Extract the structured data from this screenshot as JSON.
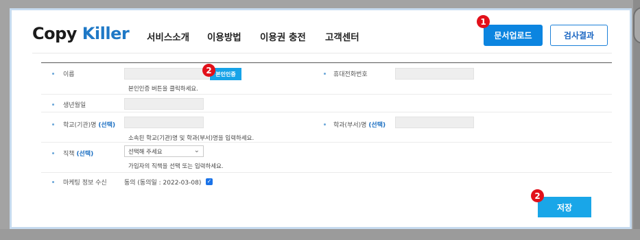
{
  "header": {
    "logo": {
      "part1": "Copy",
      "part2": "Killer"
    },
    "nav": [
      "서비스소개",
      "이용방법",
      "이용권 충전",
      "고객센터"
    ],
    "upload_button": "문서업로드",
    "result_button": "검사결과"
  },
  "badges": {
    "one": "1",
    "two": "2"
  },
  "form": {
    "name": {
      "label": "이름",
      "verify_button": "본인인증",
      "help": "본인인증 버튼을 클릭하세요."
    },
    "phone": {
      "label": "휴대전화번호"
    },
    "birth": {
      "label": "생년월일"
    },
    "school": {
      "label": "학교(기관)명",
      "select": "(선택)",
      "help": "소속된 학교(기관)명 및 학과(부서)명을 입력하세요."
    },
    "dept": {
      "label": "학과(부서)명",
      "select": "(선택)"
    },
    "job": {
      "label": "직책",
      "select": "(선택)",
      "dropdown": "선택해 주세요",
      "help": "가입자의 직책을 선택 또는 입력하세요."
    },
    "marketing": {
      "label": "마케팅 정보 수신",
      "text": "동의 (동의일 : 2022-03-08)",
      "checked": true
    }
  },
  "save_button": "저장",
  "colors": {
    "primary": "#0c85e0",
    "save": "#19a6e8",
    "badge": "#e2101a",
    "select_link": "#1b6fc2"
  }
}
